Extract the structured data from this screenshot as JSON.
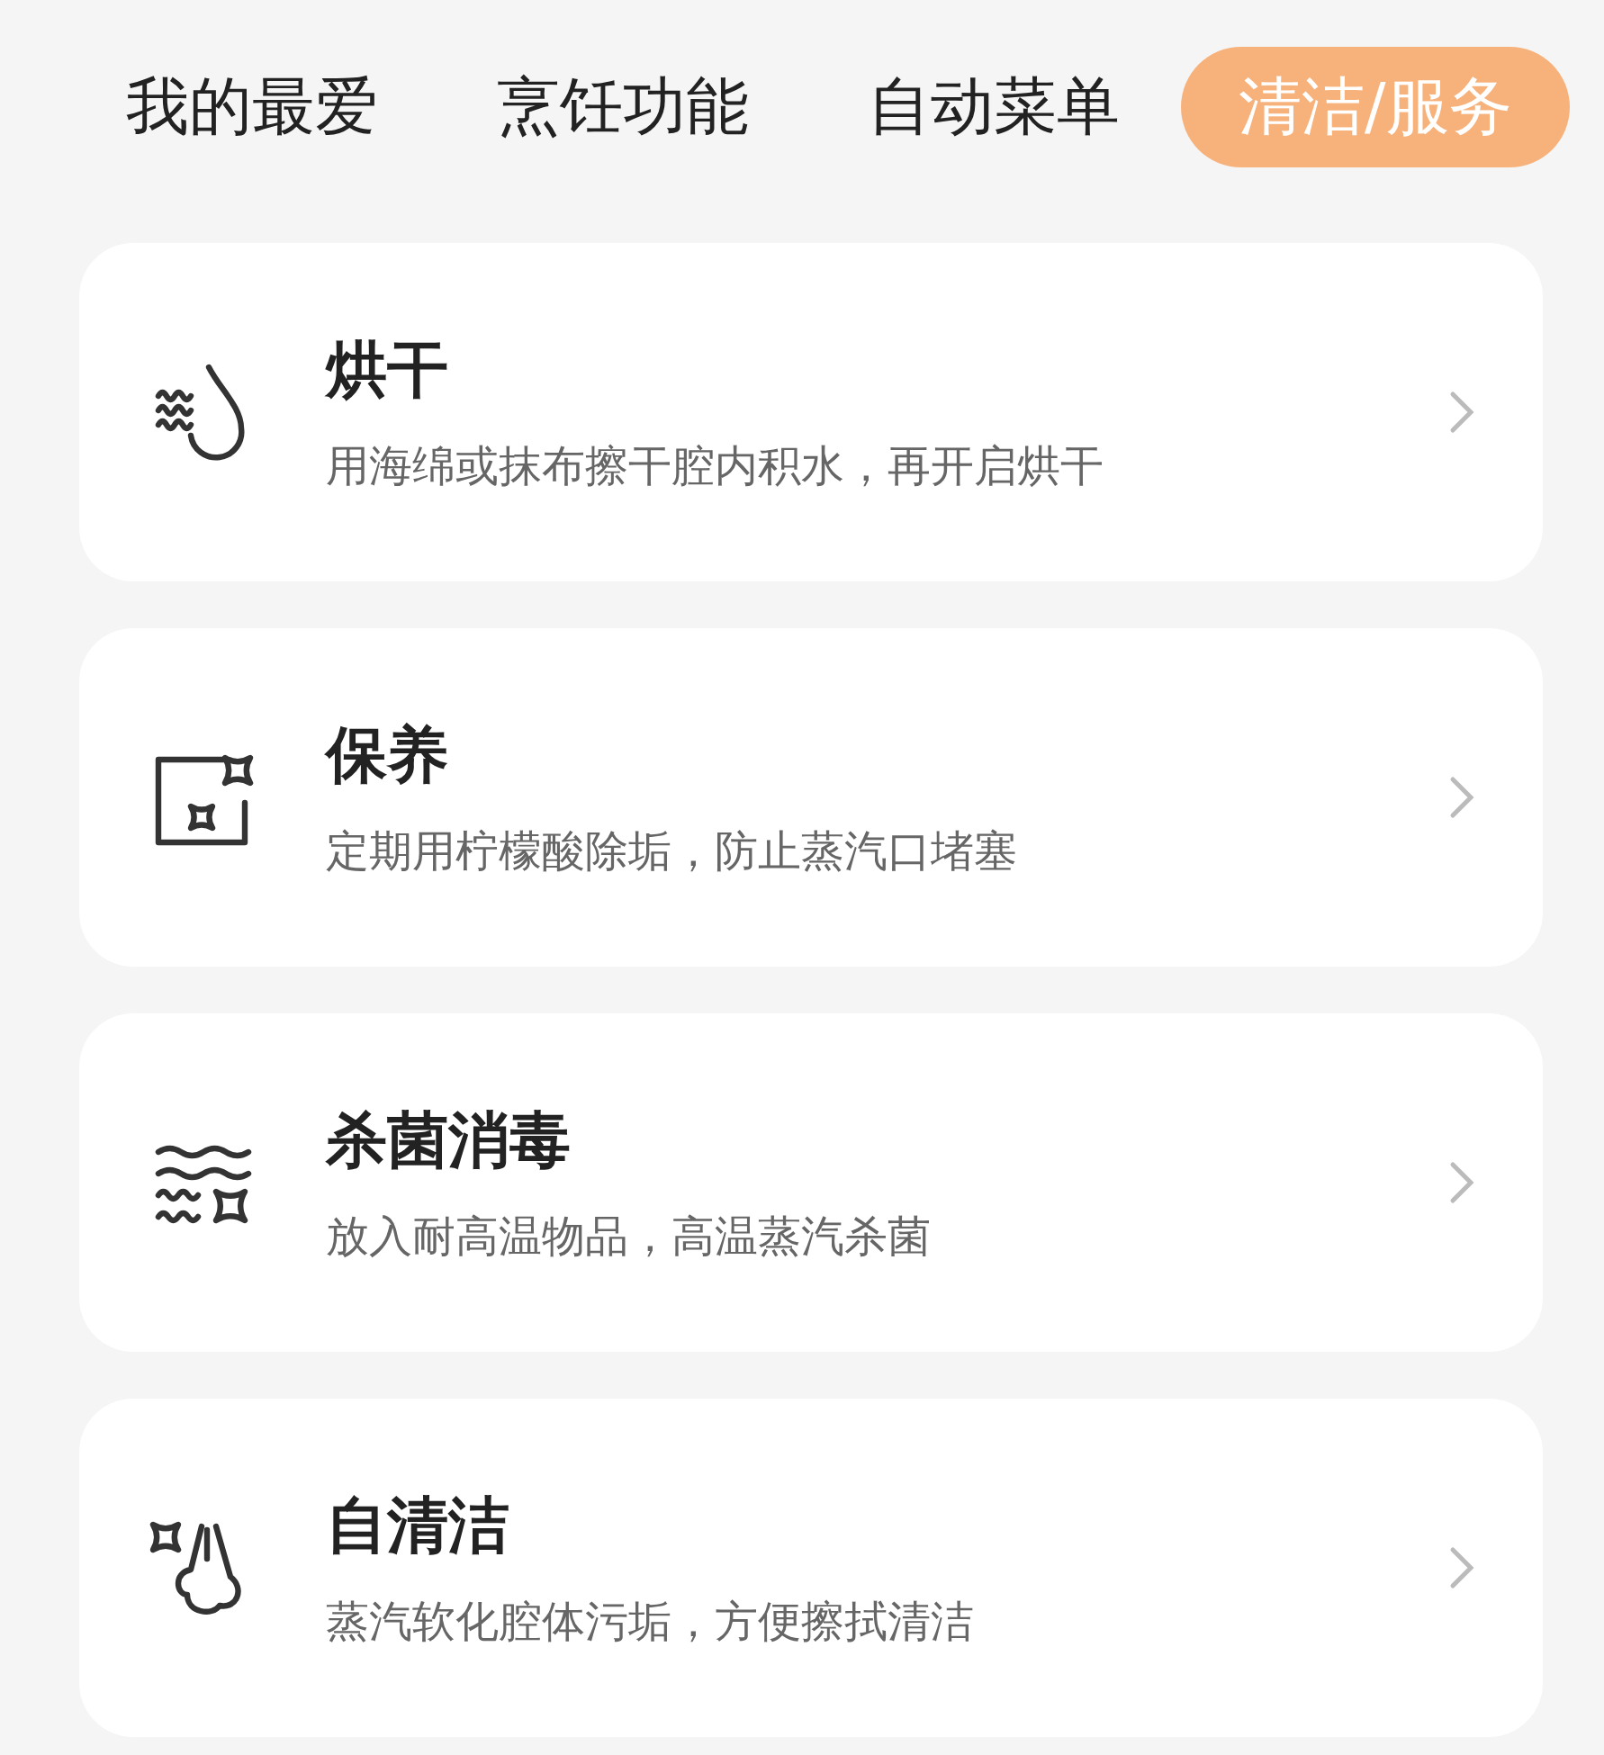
{
  "tabs": [
    {
      "label": "我的最爱",
      "selected": false
    },
    {
      "label": "烹饪功能",
      "selected": false
    },
    {
      "label": "自动菜单",
      "selected": false
    },
    {
      "label": "清洁/服务",
      "selected": true
    }
  ],
  "items": [
    {
      "kind": "drying",
      "title": "烘干",
      "description": "用海绵或抹布擦干腔内积水，再开启烘干"
    },
    {
      "kind": "maintenance",
      "title": "保养",
      "description": "定期用柠檬酸除垢，防止蒸汽口堵塞"
    },
    {
      "kind": "sterilize",
      "title": "杀菌消毒",
      "description": "放入耐高温物品，高温蒸汽杀菌"
    },
    {
      "kind": "selfclean",
      "title": "自清洁",
      "description": "蒸汽软化腔体污垢，方便擦拭清洁"
    }
  ]
}
